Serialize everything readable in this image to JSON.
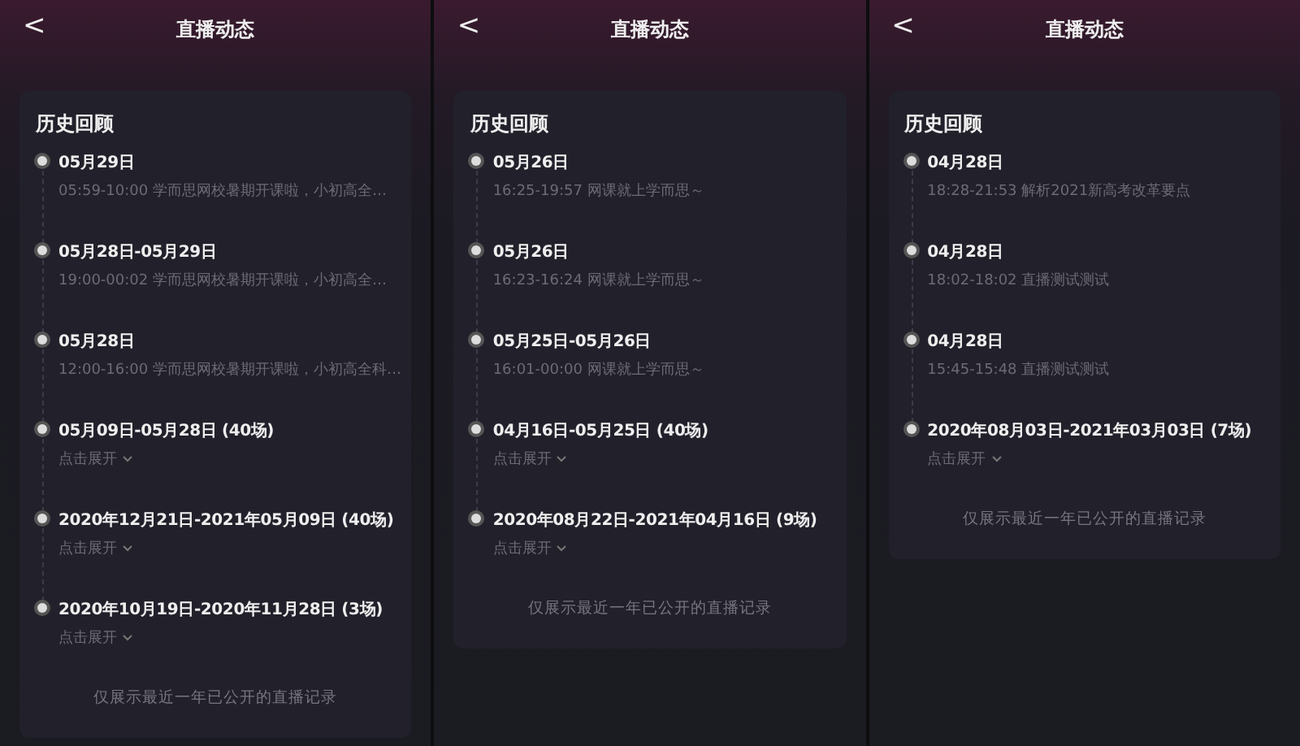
{
  "panels": [
    {
      "back": "<",
      "title": "直播动态",
      "section_title": "历史回顾",
      "items": [
        {
          "kind": "session",
          "date": "05月29日",
          "detail": "05:59-10:00 学而思网校暑期开课啦，小初高全…"
        },
        {
          "kind": "session",
          "date": "05月28日-05月29日",
          "detail": "19:00-00:02 学而思网校暑期开课啦，小初高全…"
        },
        {
          "kind": "session",
          "date": "05月28日",
          "detail": "12:00-16:00 学而思网校暑期开课啦，小初高全科…"
        },
        {
          "kind": "group",
          "date": "05月09日-05月28日 (40场)",
          "expand": "点击展开"
        },
        {
          "kind": "group",
          "date": "2020年12月21日-2021年05月09日 (40场)",
          "expand": "点击展开"
        },
        {
          "kind": "group",
          "date": "2020年10月19日-2020年11月28日 (3场)",
          "expand": "点击展开"
        }
      ],
      "footer": "仅展示最近一年已公开的直播记录"
    },
    {
      "back": "<",
      "title": "直播动态",
      "section_title": "历史回顾",
      "items": [
        {
          "kind": "session",
          "date": "05月26日",
          "detail": "16:25-19:57 网课就上学而思～"
        },
        {
          "kind": "session",
          "date": "05月26日",
          "detail": "16:23-16:24 网课就上学而思～"
        },
        {
          "kind": "session",
          "date": "05月25日-05月26日",
          "detail": "16:01-00:00 网课就上学而思～"
        },
        {
          "kind": "group",
          "date": "04月16日-05月25日 (40场)",
          "expand": "点击展开"
        },
        {
          "kind": "group",
          "date": "2020年08月22日-2021年04月16日 (9场)",
          "expand": "点击展开"
        }
      ],
      "footer": "仅展示最近一年已公开的直播记录"
    },
    {
      "back": "<",
      "title": "直播动态",
      "section_title": "历史回顾",
      "items": [
        {
          "kind": "session",
          "date": "04月28日",
          "detail": "18:28-21:53 解析2021新高考改革要点"
        },
        {
          "kind": "session",
          "date": "04月28日",
          "detail": "18:02-18:02 直播测试测试"
        },
        {
          "kind": "session",
          "date": "04月28日",
          "detail": "15:45-15:48 直播测试测试"
        },
        {
          "kind": "group",
          "date": "2020年08月03日-2021年03月03日 (7场)",
          "expand": "点击展开"
        }
      ],
      "footer": "仅展示最近一年已公开的直播记录"
    }
  ]
}
